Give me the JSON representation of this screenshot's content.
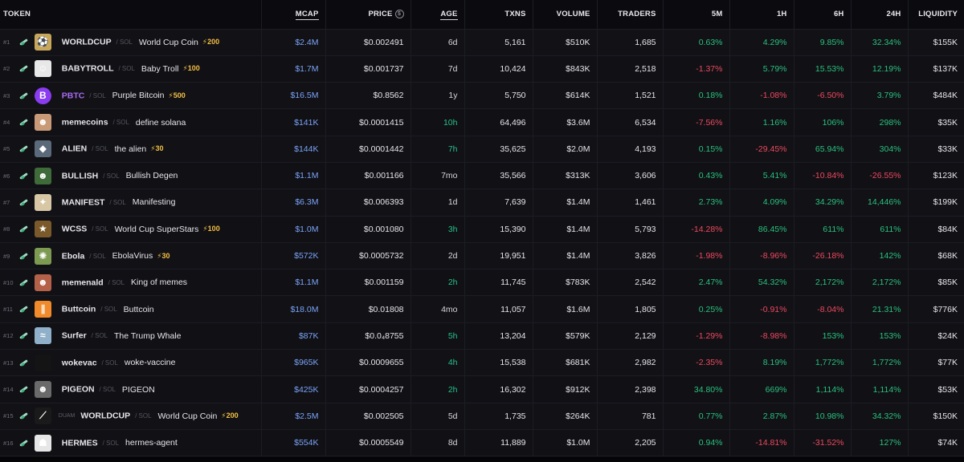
{
  "colors": {
    "background": "#0b0b0f",
    "row": "#111116",
    "mcap": "#7ba4f7",
    "positive": "#2ac27d",
    "negative": "#ef4a5e",
    "boost": "#f5c043",
    "purple_symbol": "#a86cf2"
  },
  "icons": {
    "chain": "solana-pump-icon",
    "price_header": "dollar-coin-icon",
    "boost": "lightning-bolt-icon"
  },
  "table": {
    "columns": [
      {
        "key": "token",
        "label": "TOKEN"
      },
      {
        "key": "mcap",
        "label": "MCAP"
      },
      {
        "key": "price",
        "label": "PRICE"
      },
      {
        "key": "age",
        "label": "AGE"
      },
      {
        "key": "txns",
        "label": "TXNS"
      },
      {
        "key": "volume",
        "label": "VOLUME"
      },
      {
        "key": "traders",
        "label": "TRADERS"
      },
      {
        "key": "m5",
        "label": "5M"
      },
      {
        "key": "h1",
        "label": "1H"
      },
      {
        "key": "h6",
        "label": "6H"
      },
      {
        "key": "h24",
        "label": "24H"
      },
      {
        "key": "liquidity",
        "label": "LIQUIDITY"
      }
    ],
    "rows": [
      {
        "rank": "#1",
        "prefix": "",
        "symbol": "WORLDCUP",
        "chain": "SOL",
        "name": "World Cup Coin",
        "boost": "⚡200",
        "avatar_color": "#c9a75a",
        "avatar_glyph": "⚽",
        "mcap": "$2.4M",
        "price": "$0.002491",
        "age": "6d",
        "txns": "5,161",
        "volume": "$510K",
        "traders": "1,685",
        "m5": "0.63%",
        "h1": "4.29%",
        "h6": "9.85%",
        "h24": "32.34%",
        "liquidity": "$155K"
      },
      {
        "rank": "#2",
        "prefix": "",
        "symbol": "BABYTROLL",
        "chain": "SOL",
        "name": "Baby Troll",
        "boost": "⚡100",
        "avatar_color": "#e8e8e8",
        "avatar_glyph": "☺",
        "mcap": "$1.7M",
        "price": "$0.001737",
        "age": "7d",
        "txns": "10,424",
        "volume": "$843K",
        "traders": "2,518",
        "m5": "-1.37%",
        "h1": "5.79%",
        "h6": "15.53%",
        "h24": "12.19%",
        "liquidity": "$137K"
      },
      {
        "rank": "#3",
        "prefix": "",
        "symbol": "PBTC",
        "chain": "SOL",
        "name": "Purple Bitcoin",
        "boost": "⚡500",
        "avatar_color": "#8a3cf0",
        "avatar_glyph": "B",
        "mcap": "$16.5M",
        "price": "$0.8562",
        "age": "1y",
        "txns": "5,750",
        "volume": "$614K",
        "traders": "1,521",
        "m5": "0.18%",
        "h1": "-1.08%",
        "h6": "-6.50%",
        "h24": "3.79%",
        "liquidity": "$484K"
      },
      {
        "rank": "#4",
        "prefix": "",
        "symbol": "memecoins",
        "chain": "SOL",
        "name": "define solana",
        "boost": "",
        "avatar_color": "#c89a78",
        "avatar_glyph": "☻",
        "mcap": "$141K",
        "price": "$0.0001415",
        "age": "10h",
        "txns": "64,496",
        "volume": "$3.6M",
        "traders": "6,534",
        "m5": "-7.56%",
        "h1": "1.16%",
        "h6": "106%",
        "h24": "298%",
        "liquidity": "$35K"
      },
      {
        "rank": "#5",
        "prefix": "",
        "symbol": "ALIEN",
        "chain": "SOL",
        "name": "the alien",
        "boost": "⚡30",
        "avatar_color": "#5a6a7a",
        "avatar_glyph": "◆",
        "mcap": "$144K",
        "price": "$0.0001442",
        "age": "7h",
        "txns": "35,625",
        "volume": "$2.0M",
        "traders": "4,193",
        "m5": "0.15%",
        "h1": "-29.45%",
        "h6": "65.94%",
        "h24": "304%",
        "liquidity": "$33K"
      },
      {
        "rank": "#6",
        "prefix": "",
        "symbol": "BULLISH",
        "chain": "SOL",
        "name": "Bullish Degen",
        "boost": "",
        "avatar_color": "#3f6a3a",
        "avatar_glyph": "☻",
        "mcap": "$1.1M",
        "price": "$0.001166",
        "age": "7mo",
        "txns": "35,566",
        "volume": "$313K",
        "traders": "3,606",
        "m5": "0.43%",
        "h1": "5.41%",
        "h6": "-10.84%",
        "h24": "-26.55%",
        "liquidity": "$123K"
      },
      {
        "rank": "#7",
        "prefix": "",
        "symbol": "MANIFEST",
        "chain": "SOL",
        "name": "Manifesting",
        "boost": "",
        "avatar_color": "#d8c7a4",
        "avatar_glyph": "✦",
        "mcap": "$6.3M",
        "price": "$0.006393",
        "age": "1d",
        "txns": "7,639",
        "volume": "$1.4M",
        "traders": "1,461",
        "m5": "2.73%",
        "h1": "4.09%",
        "h6": "34.29%",
        "h24": "14,446%",
        "liquidity": "$199K"
      },
      {
        "rank": "#8",
        "prefix": "",
        "symbol": "WCSS",
        "chain": "SOL",
        "name": "World Cup SuperStars",
        "boost": "⚡100",
        "avatar_color": "#7a5a2a",
        "avatar_glyph": "★",
        "mcap": "$1.0M",
        "price": "$0.001080",
        "age": "3h",
        "txns": "15,390",
        "volume": "$1.4M",
        "traders": "5,793",
        "m5": "-14.28%",
        "h1": "86.45%",
        "h6": "611%",
        "h24": "611%",
        "liquidity": "$84K"
      },
      {
        "rank": "#9",
        "prefix": "",
        "symbol": "Ebola",
        "chain": "SOL",
        "name": "EbolaVirus",
        "boost": "⚡30",
        "avatar_color": "#7d9a52",
        "avatar_glyph": "✺",
        "mcap": "$572K",
        "price": "$0.0005732",
        "age": "2d",
        "txns": "19,951",
        "volume": "$1.4M",
        "traders": "3,826",
        "m5": "-1.98%",
        "h1": "-8.96%",
        "h6": "-26.18%",
        "h24": "142%",
        "liquidity": "$68K"
      },
      {
        "rank": "#10",
        "prefix": "",
        "symbol": "memenald",
        "chain": "SOL",
        "name": "King of memes",
        "boost": "",
        "avatar_color": "#b5614a",
        "avatar_glyph": "☻",
        "mcap": "$1.1M",
        "price": "$0.001159",
        "age": "2h",
        "txns": "11,745",
        "volume": "$783K",
        "traders": "2,542",
        "m5": "2.47%",
        "h1": "54.32%",
        "h6": "2,172%",
        "h24": "2,172%",
        "liquidity": "$85K"
      },
      {
        "rank": "#11",
        "prefix": "",
        "symbol": "Buttcoin",
        "chain": "SOL",
        "name": "Buttcoin",
        "boost": "",
        "avatar_color": "#f08a2a",
        "avatar_glyph": "∥",
        "mcap": "$18.0M",
        "price": "$0.01808",
        "age": "4mo",
        "txns": "11,057",
        "volume": "$1.6M",
        "traders": "1,805",
        "m5": "0.25%",
        "h1": "-0.91%",
        "h6": "-8.04%",
        "h24": "21.31%",
        "liquidity": "$776K"
      },
      {
        "rank": "#12",
        "prefix": "",
        "symbol": "Surfer",
        "chain": "SOL",
        "name": "The Trump Whale",
        "boost": "",
        "avatar_color": "#8fb0c8",
        "avatar_glyph": "≈",
        "mcap": "$87K",
        "price": "$0.0₄8755",
        "age": "5h",
        "txns": "13,204",
        "volume": "$579K",
        "traders": "2,129",
        "m5": "-1.29%",
        "h1": "-8.98%",
        "h6": "153%",
        "h24": "153%",
        "liquidity": "$24K"
      },
      {
        "rank": "#13",
        "prefix": "",
        "symbol": "wokevac",
        "chain": "SOL",
        "name": "woke-vaccine",
        "boost": "",
        "avatar_color": "#141414",
        "avatar_glyph": "",
        "mcap": "$965K",
        "price": "$0.0009655",
        "age": "4h",
        "txns": "15,538",
        "volume": "$681K",
        "traders": "2,982",
        "m5": "-2.35%",
        "h1": "8.19%",
        "h6": "1,772%",
        "h24": "1,772%",
        "liquidity": "$77K"
      },
      {
        "rank": "#14",
        "prefix": "",
        "symbol": "PIGEON",
        "chain": "SOL",
        "name": "PIGEON",
        "boost": "",
        "avatar_color": "#6a6a6a",
        "avatar_glyph": "☻",
        "mcap": "$425K",
        "price": "$0.0004257",
        "age": "2h",
        "txns": "16,302",
        "volume": "$912K",
        "traders": "2,398",
        "m5": "34.80%",
        "h1": "669%",
        "h6": "1,114%",
        "h24": "1,114%",
        "liquidity": "$53K"
      },
      {
        "rank": "#15",
        "prefix": "DUAM",
        "symbol": "WORLDCUP",
        "chain": "SOL",
        "name": "World Cup Coin",
        "boost": "⚡200",
        "avatar_color": "#1a1a1a",
        "avatar_glyph": "⟋",
        "mcap": "$2.5M",
        "price": "$0.002505",
        "age": "5d",
        "txns": "1,735",
        "volume": "$264K",
        "traders": "781",
        "m5": "0.77%",
        "h1": "2.87%",
        "h6": "10.98%",
        "h24": "34.32%",
        "liquidity": "$150K"
      },
      {
        "rank": "#16",
        "prefix": "",
        "symbol": "HERMES",
        "chain": "SOL",
        "name": "hermes-agent",
        "boost": "",
        "avatar_color": "#e6e6e6",
        "avatar_glyph": "☗",
        "mcap": "$554K",
        "price": "$0.0005549",
        "age": "8d",
        "txns": "11,889",
        "volume": "$1.0M",
        "traders": "2,205",
        "m5": "0.94%",
        "h1": "-14.81%",
        "h6": "-31.52%",
        "h24": "127%",
        "liquidity": "$74K"
      }
    ]
  }
}
